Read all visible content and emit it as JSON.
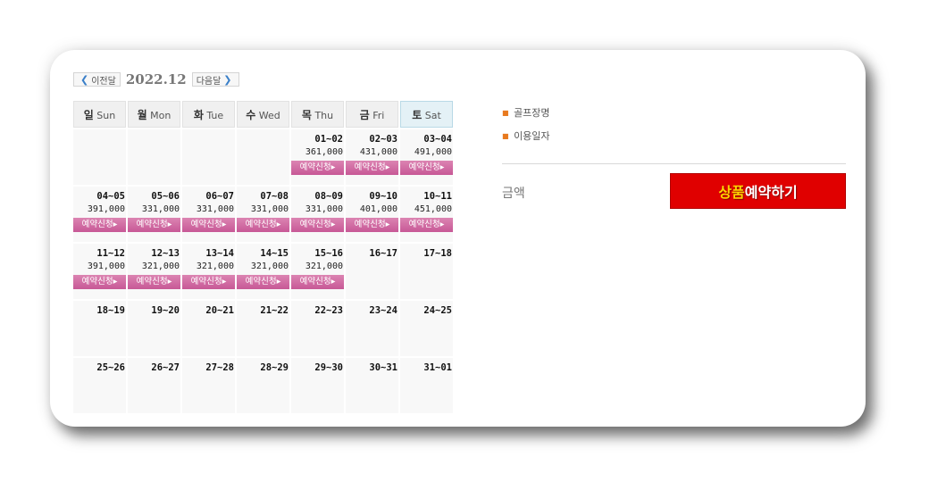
{
  "calendar": {
    "prev_label": "이전달",
    "next_label": "다음달",
    "month": "2022.12",
    "weekdays": [
      {
        "kr": "일",
        "en": "Sun"
      },
      {
        "kr": "월",
        "en": "Mon"
      },
      {
        "kr": "화",
        "en": "Tue"
      },
      {
        "kr": "수",
        "en": "Wed"
      },
      {
        "kr": "목",
        "en": "Thu"
      },
      {
        "kr": "금",
        "en": "Fri"
      },
      {
        "kr": "토",
        "en": "Sat"
      }
    ],
    "reserve_label": "예약신청▸",
    "weeks": [
      [
        {
          "date": "",
          "price": ""
        },
        {
          "date": "",
          "price": ""
        },
        {
          "date": "",
          "price": ""
        },
        {
          "date": "",
          "price": ""
        },
        {
          "date": "01~02",
          "price": "361,000"
        },
        {
          "date": "02~03",
          "price": "431,000"
        },
        {
          "date": "03~04",
          "price": "491,000"
        }
      ],
      [
        {
          "date": "04~05",
          "price": "391,000"
        },
        {
          "date": "05~06",
          "price": "331,000"
        },
        {
          "date": "06~07",
          "price": "331,000"
        },
        {
          "date": "07~08",
          "price": "331,000"
        },
        {
          "date": "08~09",
          "price": "331,000"
        },
        {
          "date": "09~10",
          "price": "401,000"
        },
        {
          "date": "10~11",
          "price": "451,000"
        }
      ],
      [
        {
          "date": "11~12",
          "price": "391,000"
        },
        {
          "date": "12~13",
          "price": "321,000"
        },
        {
          "date": "13~14",
          "price": "321,000"
        },
        {
          "date": "14~15",
          "price": "321,000"
        },
        {
          "date": "15~16",
          "price": "321,000"
        },
        {
          "date": "16~17",
          "price": ""
        },
        {
          "date": "17~18",
          "price": ""
        }
      ],
      [
        {
          "date": "18~19",
          "price": ""
        },
        {
          "date": "19~20",
          "price": ""
        },
        {
          "date": "20~21",
          "price": ""
        },
        {
          "date": "21~22",
          "price": ""
        },
        {
          "date": "22~23",
          "price": ""
        },
        {
          "date": "23~24",
          "price": ""
        },
        {
          "date": "24~25",
          "price": ""
        }
      ],
      [
        {
          "date": "25~26",
          "price": ""
        },
        {
          "date": "26~27",
          "price": ""
        },
        {
          "date": "27~28",
          "price": ""
        },
        {
          "date": "28~29",
          "price": ""
        },
        {
          "date": "29~30",
          "price": ""
        },
        {
          "date": "30~31",
          "price": ""
        },
        {
          "date": "31~01",
          "price": ""
        }
      ]
    ]
  },
  "info": {
    "golf_course_label": "골프장명",
    "use_date_label": "이용일자",
    "amount_label": "금액",
    "book_button_highlight": "상품",
    "book_button_rest": "예약하기"
  },
  "colors": {
    "book_button": "#e00000",
    "book_highlight": "#ffd400",
    "reserve_button": "#c75896",
    "bullet": "#e87a1f"
  }
}
